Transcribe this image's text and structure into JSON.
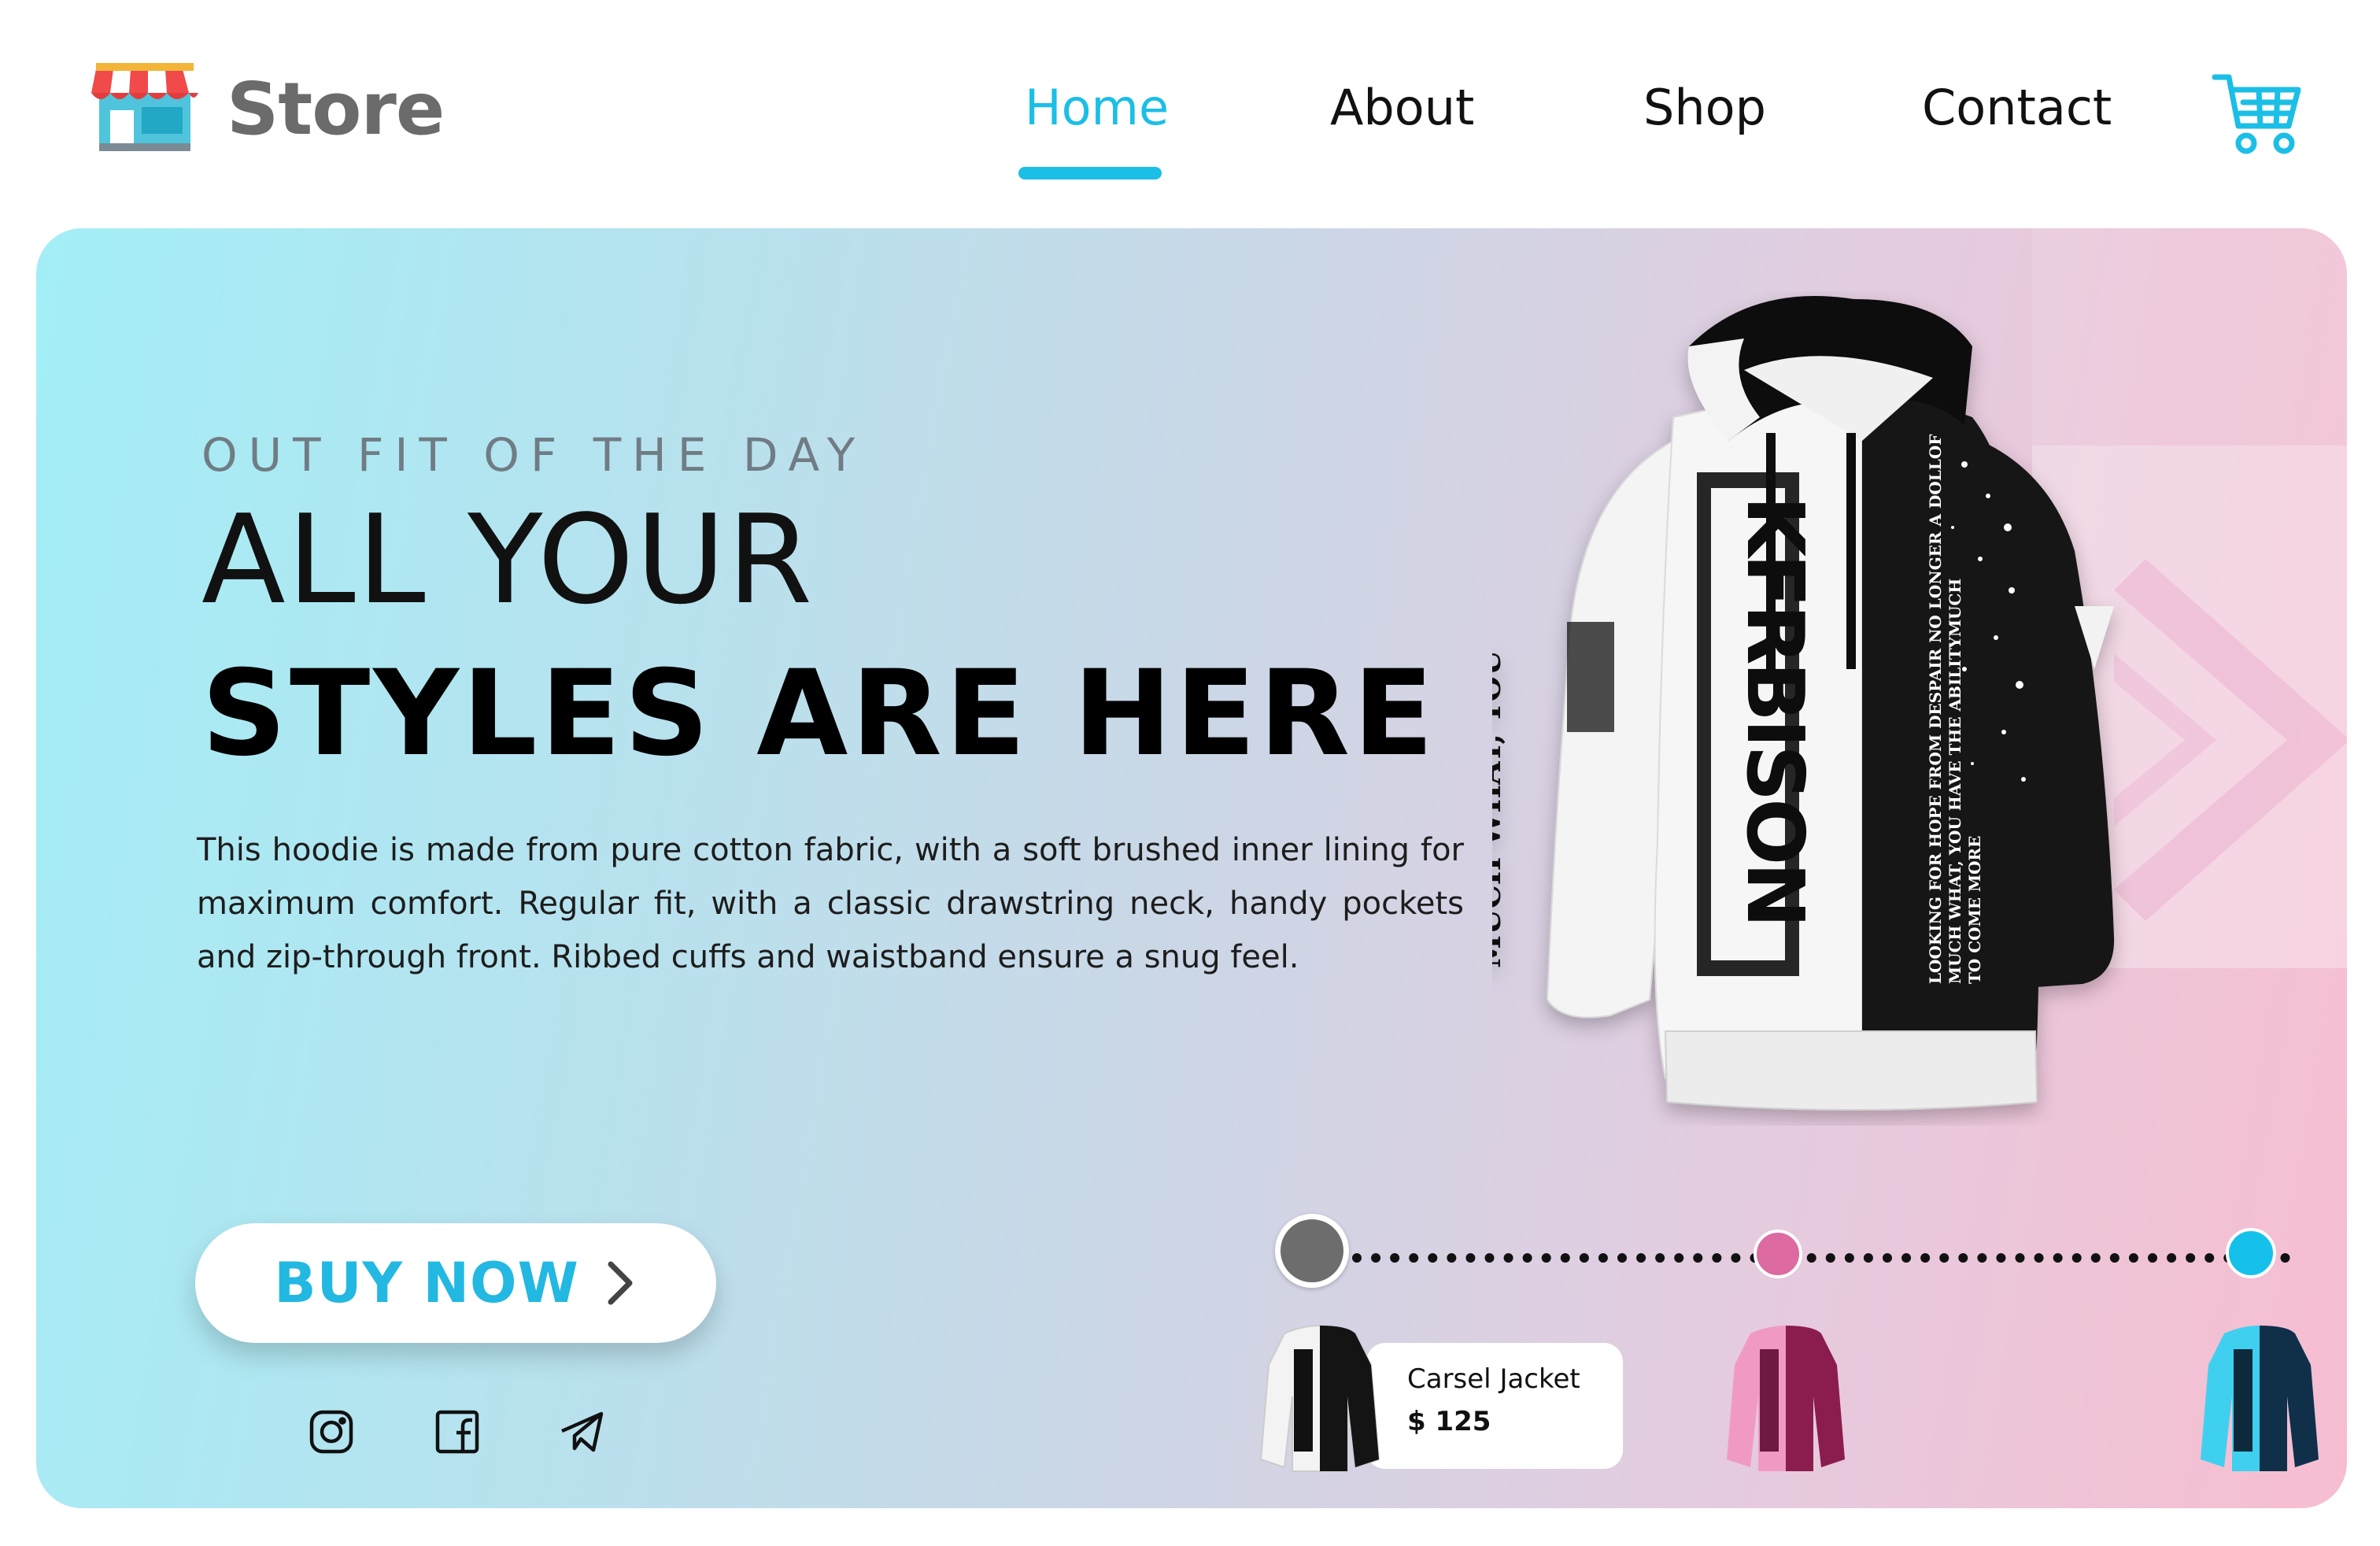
{
  "header": {
    "brand": "Store",
    "logo_icon": "storefront-icon",
    "nav": [
      {
        "label": "Home",
        "active": true
      },
      {
        "label": "About",
        "active": false
      },
      {
        "label": "Shop",
        "active": false
      },
      {
        "label": "Contact",
        "active": false
      }
    ],
    "cart_icon": "shopping-cart-icon",
    "accent_color": "#1bbfe6"
  },
  "hero": {
    "eyebrow": "OUT FIT OF THE DAY",
    "headline_light": "ALL YOUR",
    "headline_bold": "STYLES ARE HERE",
    "description": "This hoodie is made from pure cotton fabric, with a soft brushed inner lining for maximum comfort. Regular fit, with a classic drawstring neck, handy pockets and zip-through front. Ribbed cuffs and waistband ensure a snug feel.",
    "cta_label": "BUY NOW",
    "cta_icon": "chevron-right-icon",
    "social": [
      {
        "icon": "instagram-icon"
      },
      {
        "icon": "facebook-icon"
      },
      {
        "icon": "telegram-icon"
      }
    ],
    "product_image": "black-white-hoodie-image"
  },
  "color_selector": {
    "options": [
      {
        "color": "#6d6d6d",
        "selected": true
      },
      {
        "color": "#dd6aa0",
        "selected": false
      },
      {
        "color": "#15c1ea",
        "selected": false
      }
    ],
    "card": {
      "name": "Carsel Jacket",
      "price": "$ 125"
    }
  }
}
